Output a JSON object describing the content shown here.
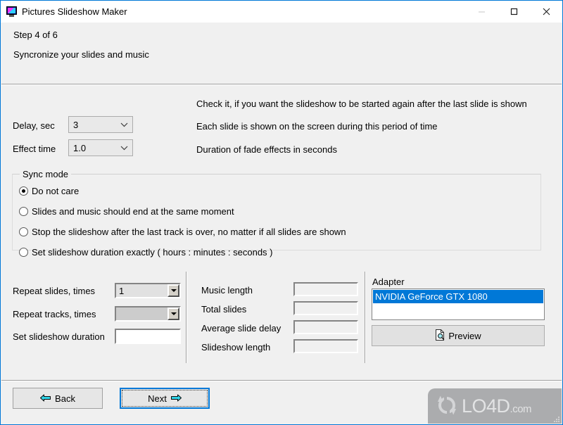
{
  "window": {
    "title": "Pictures Slideshow Maker",
    "icon": "monitor-picture-icon",
    "controls": {
      "minimize": "minimize-icon",
      "maximize": "maximize-icon",
      "close": "close-icon"
    }
  },
  "header": {
    "step": "Step 4 of 6",
    "description": "Syncronize your slides and music"
  },
  "options": {
    "loop_note": "Check it, if you want the slideshow to be started again after the last slide is shown",
    "delay": {
      "label": "Delay, sec",
      "value": "3",
      "note": "Each slide is shown on the screen during this period of time"
    },
    "effect_time": {
      "label": "Effect time",
      "value": "1.0",
      "note": "Duration of fade effects in seconds"
    }
  },
  "sync_mode": {
    "title": "Sync mode",
    "items": [
      {
        "label": "Do not care",
        "selected": true
      },
      {
        "label": "Slides and music should end at the same moment",
        "selected": false
      },
      {
        "label": "Stop the slideshow after the last track is over, no matter if all slides are shown",
        "selected": false
      },
      {
        "label": "Set slideshow duration exactly  ( hours : minutes : seconds )",
        "selected": false
      }
    ]
  },
  "repeat": {
    "slides": {
      "label": "Repeat slides, times",
      "value": "1"
    },
    "tracks": {
      "label": "Repeat tracks, times",
      "value": ""
    },
    "duration": {
      "label": "Set slideshow duration",
      "value": ""
    }
  },
  "stats": [
    {
      "label": "Music length",
      "value": ""
    },
    {
      "label": "Total slides",
      "value": ""
    },
    {
      "label": "Average slide delay",
      "value": ""
    },
    {
      "label": "Slideshow length",
      "value": ""
    }
  ],
  "adapter": {
    "label": "Adapter",
    "items": [
      "NVIDIA GeForce GTX 1080"
    ],
    "selected_index": 0,
    "preview_button": "Preview",
    "preview_icon": "document-magnifier-icon"
  },
  "footer": {
    "back": "Back",
    "back_icon": "arrow-left-icon",
    "next": "Next",
    "next_icon": "arrow-right-icon"
  },
  "watermark": {
    "brand": "LO4D",
    "suffix": ".com",
    "logo": "refresh-arrows-icon"
  },
  "colors": {
    "window_border": "#0078d7",
    "accent": "#0078d7",
    "face": "#f0f0f0",
    "arrow_cyan": "#00c8e0"
  }
}
